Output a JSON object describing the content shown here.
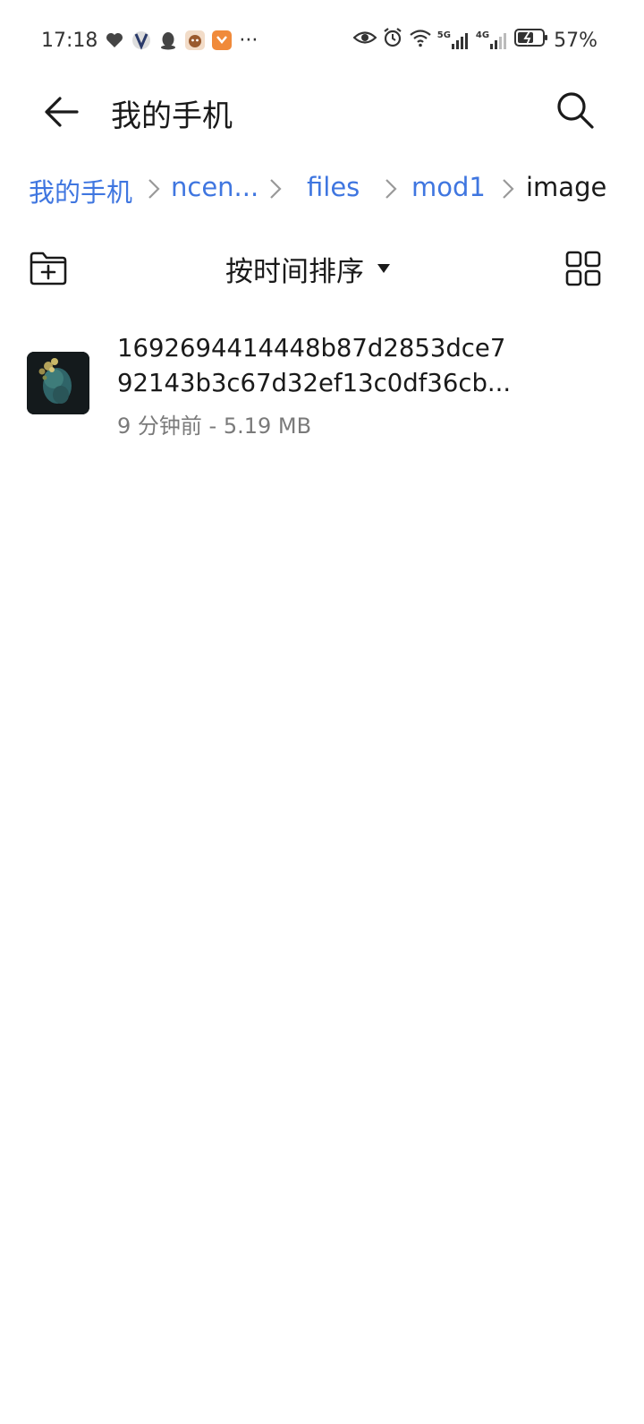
{
  "status_bar": {
    "time": "17:18",
    "left_icons": [
      "heart-shield-icon",
      "app-icon",
      "qq-penguin-icon",
      "monkey-app-icon",
      "orange-app-icon"
    ],
    "more": "···",
    "right_icons": [
      "eye-icon",
      "alarm-icon",
      "wifi-icon",
      "signal-5g-icon",
      "signal-4g-icon",
      "battery-charging-icon"
    ],
    "net_5g": "5G",
    "net_4g": "4G",
    "battery": "57%"
  },
  "header": {
    "title": "我的手机",
    "back_icon": "arrow-left-icon",
    "search_icon": "search-icon"
  },
  "breadcrumb": {
    "items": [
      {
        "label": "我的手机"
      },
      {
        "label": "ncen..."
      },
      {
        "label": "files"
      },
      {
        "label": "mod1"
      },
      {
        "label": "image"
      }
    ]
  },
  "toolbar": {
    "sort_label": "按时间排序",
    "sort_caret_icon": "caret-down-icon",
    "new_folder_icon": "new-folder-icon",
    "view_toggle_icon": "grid-view-icon"
  },
  "files": [
    {
      "name_line1": "1692694414448b87d2853dce7",
      "name_line2": "92143b3c67d32ef13c0df36cb...",
      "meta": "9 分钟前 - 5.19 MB"
    }
  ],
  "colors": {
    "link": "#3f76e0",
    "text": "#1a1a1a",
    "meta": "#7a7a7a",
    "background": "#ffffff"
  }
}
